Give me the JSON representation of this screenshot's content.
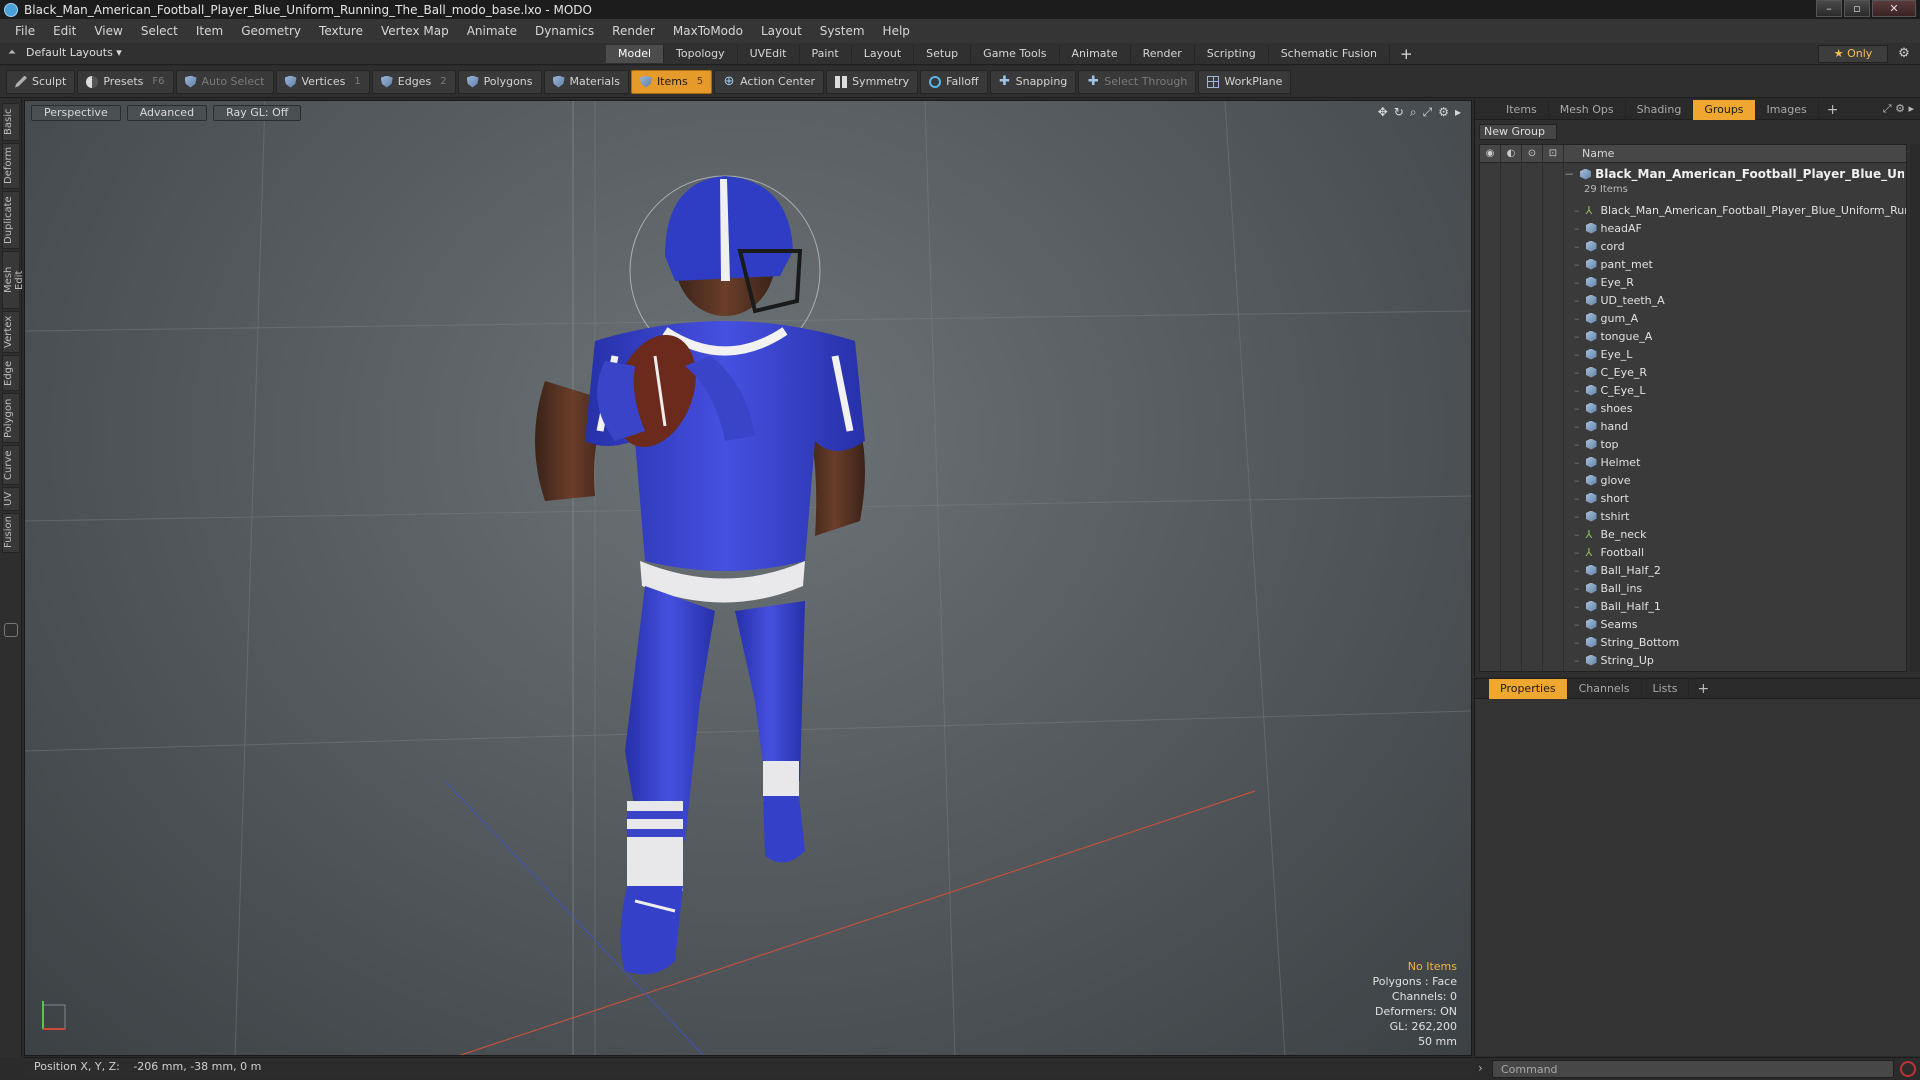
{
  "window": {
    "title": "Black_Man_American_Football_Player_Blue_Uniform_Running_The_Ball_modo_base.lxo - MODO"
  },
  "menu": [
    "File",
    "Edit",
    "View",
    "Select",
    "Item",
    "Geometry",
    "Texture",
    "Vertex Map",
    "Animate",
    "Dynamics",
    "Render",
    "MaxToModo",
    "Layout",
    "System",
    "Help"
  ],
  "layout_selector": "Default Layouts ▾",
  "layout_tabs": [
    {
      "label": "Model",
      "active": true
    },
    {
      "label": "Topology",
      "active": false
    },
    {
      "label": "UVEdit",
      "active": false
    },
    {
      "label": "Paint",
      "active": false
    },
    {
      "label": "Layout",
      "active": false
    },
    {
      "label": "Setup",
      "active": false
    },
    {
      "label": "Game Tools",
      "active": false
    },
    {
      "label": "Animate",
      "active": false
    },
    {
      "label": "Render",
      "active": false
    },
    {
      "label": "Scripting",
      "active": false
    },
    {
      "label": "Schematic Fusion",
      "active": false
    }
  ],
  "only_button": "★ Only",
  "toolbar": {
    "sculpt": "Sculpt",
    "presets": "Presets",
    "presets_key": "F6",
    "auto_select": "Auto Select",
    "vertices": "Vertices",
    "vertices_key": "1",
    "edges": "Edges",
    "edges_key": "2",
    "polygons": "Polygons",
    "materials": "Materials",
    "items": "Items",
    "items_key": "5",
    "action_center": "Action Center",
    "symmetry": "Symmetry",
    "falloff": "Falloff",
    "snapping": "Snapping",
    "select_through": "Select Through",
    "workplane": "WorkPlane"
  },
  "left_tabs": [
    "Basic",
    "Deform",
    "Duplicate",
    "Mesh Edit",
    "Vertex",
    "Edge",
    "Polygon",
    "Curve",
    "UV",
    "Fusion"
  ],
  "viewport": {
    "view_mode": "Perspective",
    "shading": "Advanced",
    "raygl": "Ray GL: Off",
    "stats": {
      "selection": "No Items",
      "polygons": "Polygons : Face",
      "channels": "Channels: 0",
      "deformers": "Deformers: ON",
      "gl": "GL: 262,200",
      "distance": "50 mm"
    }
  },
  "status": {
    "label": "Position X, Y, Z:",
    "value": "-206 mm, -38 mm, 0 m"
  },
  "right_tabs": [
    {
      "label": "Items",
      "active": false
    },
    {
      "label": "Mesh Ops",
      "active": false
    },
    {
      "label": "Shading",
      "active": false
    },
    {
      "label": "Groups",
      "active": true
    },
    {
      "label": "Images",
      "active": false
    }
  ],
  "new_group": "New Group",
  "list_header": "Name",
  "group": {
    "name": "Black_Man_American_Football_Player_Blue_Unifo ...",
    "count": "29 Items"
  },
  "items": [
    {
      "name": "Black_Man_American_Football_Player_Blue_Uniform_Run ...",
      "kind": "locator"
    },
    {
      "name": "headAF",
      "kind": "mesh"
    },
    {
      "name": "cord",
      "kind": "mesh"
    },
    {
      "name": "pant_met",
      "kind": "mesh"
    },
    {
      "name": "Eye_R",
      "kind": "mesh"
    },
    {
      "name": "UD_teeth_A",
      "kind": "mesh"
    },
    {
      "name": "gum_A",
      "kind": "mesh"
    },
    {
      "name": "tongue_A",
      "kind": "mesh"
    },
    {
      "name": "Eye_L",
      "kind": "mesh"
    },
    {
      "name": "C_Eye_R",
      "kind": "mesh"
    },
    {
      "name": "C_Eye_L",
      "kind": "mesh"
    },
    {
      "name": "shoes",
      "kind": "mesh"
    },
    {
      "name": "hand",
      "kind": "mesh"
    },
    {
      "name": "top",
      "kind": "mesh"
    },
    {
      "name": "Helmet",
      "kind": "mesh"
    },
    {
      "name": "glove",
      "kind": "mesh"
    },
    {
      "name": "short",
      "kind": "mesh"
    },
    {
      "name": "tshirt",
      "kind": "mesh"
    },
    {
      "name": "Be_neck",
      "kind": "locator"
    },
    {
      "name": "Football",
      "kind": "locator"
    },
    {
      "name": "Ball_Half_2",
      "kind": "mesh"
    },
    {
      "name": "Ball_ins",
      "kind": "mesh"
    },
    {
      "name": "Ball_Half_1",
      "kind": "mesh"
    },
    {
      "name": "Seams",
      "kind": "mesh"
    },
    {
      "name": "String_Bottom",
      "kind": "mesh"
    },
    {
      "name": "String_Up",
      "kind": "mesh"
    }
  ],
  "properties_tabs": [
    {
      "label": "Properties",
      "active": true
    },
    {
      "label": "Channels",
      "active": false
    },
    {
      "label": "Lists",
      "active": false
    }
  ],
  "command": {
    "placeholder": "Command"
  },
  "colors": {
    "accent": "#f0a72f",
    "uniform": "#3440c8",
    "viewport_bg": "#565c60"
  }
}
